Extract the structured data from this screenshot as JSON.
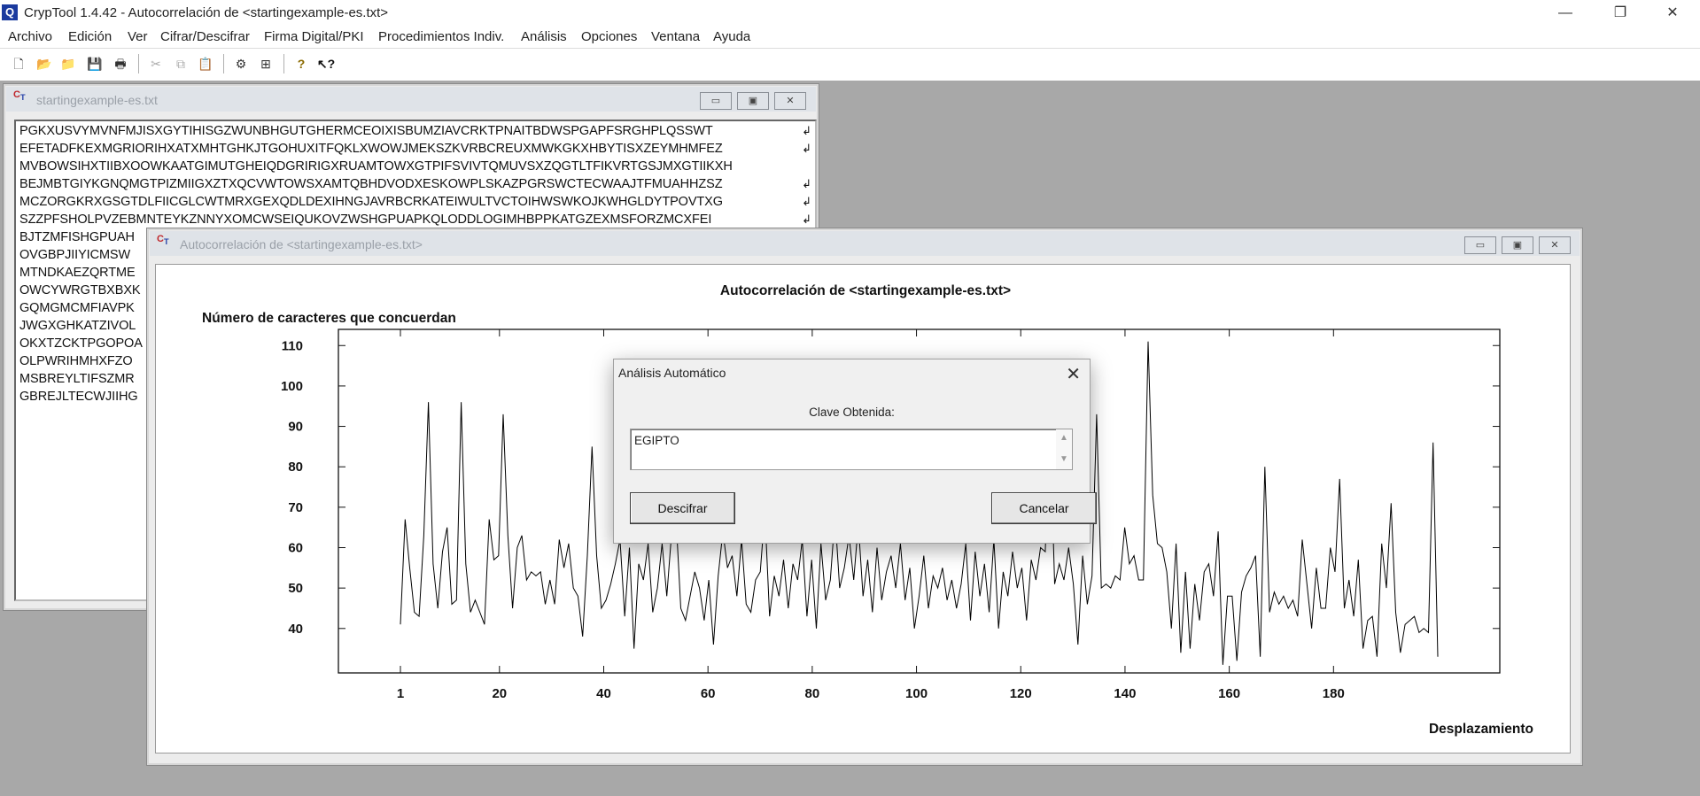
{
  "app": {
    "title": "CrypTool 1.4.42 - Autocorrelación de <startingexample-es.txt>",
    "icon_letter": "Q",
    "controls": {
      "minimize": "—",
      "restore": "❐",
      "close": "✕"
    }
  },
  "menu": [
    "Archivo",
    "Edición",
    "Ver",
    "Cifrar/Descifrar",
    "Firma Digital/PKI",
    "Procedimientos Indiv.",
    "Análisis",
    "Opciones",
    "Ventana",
    "Ayuda"
  ],
  "toolbar": {
    "icons": [
      "new-file-icon",
      "open-file-icon",
      "open-folder-icon",
      "save-icon",
      "print-icon",
      "cut-icon",
      "copy-icon",
      "paste-icon",
      "key-tool-icon",
      "windows-icon",
      "help-icon",
      "context-help-icon"
    ]
  },
  "text_window": {
    "title": "startingexample-es.txt",
    "lines": [
      "PGKXUSVYMVNFMJISXGYTIHISGZWUNBHGUTGHERMCEOIXISBUMZIAVCRKTPNAITBDWSPGAPFSRGHPLQSSWT",
      "EFETADFKEXMGRIORIHXATXMHTGHKJTGOHUXITFQKLXWOWJMEKSZKVRBCREUXMWKGKXHBYTISXZEYMHMFEZ",
      "MVBOWSIHXTIIBXOOWKAATGIMUTGHEIQDGRIRIGXRUAMTOWXGTPIFSVIVTQMUVSXZQGTLTFIKVRTGSJMXGTIIKXH",
      "BEJMBTGIYKGNQMGTPIZMIIGXZTXQCVWTOWSXAMTQBHDVODXESKOWPLSKAZPGRSWCTECWAAJTFMUAHHZSZ",
      "MCZORGKRXGSGTDLFIICGLCWTMRXGEXQDLDEXIHNGJAVRBCRKATEIWULTVCTOIHWSWKOJKWHGLDYTPOVTXG",
      "SZZPFSHOLPVZEBMNTEYKZNNYXOMCWSEIQUKOVZWSHGPUAPKQLODDLOGIMHBPPKATGZEXMSFORZMCXFEI",
      "BJTZMFISHGPUAH",
      "OVGBPJIIYICMSW",
      "MTNDKAEZQRTME",
      "OWCYWRGTBXBXK",
      "GQMGMCMFIAVPK",
      "JWGXGHKATZIVOL",
      "OKXTZCKTPGOPOA",
      "OLPWRIHMHXFZO",
      "MSBREYLTIFSZMR",
      "GBREJLTECWJIIHG"
    ],
    "wrap_mark": "↲"
  },
  "chart_window": {
    "title": "Autocorrelación de <startingexample-es.txt>"
  },
  "chart_data": {
    "type": "line",
    "title": "Autocorrelación de <startingexample-es.txt>",
    "ylabel": "Número de caracteres que concuerdan",
    "xlabel": "Desplazamiento",
    "xlim": [
      1,
      200
    ],
    "ylim": [
      29,
      114
    ],
    "x_ticks": [
      "1",
      "20",
      "40",
      "60",
      "80",
      "100",
      "120",
      "140",
      "160",
      "180"
    ],
    "x_tick_values": [
      1,
      20,
      40,
      60,
      80,
      100,
      120,
      140,
      160,
      180
    ],
    "y_ticks": [
      40,
      50,
      60,
      70,
      80,
      90,
      100,
      110
    ],
    "grid": false,
    "series": [
      {
        "x_start": 1,
        "x_step": 1,
        "values": [
          41,
          67,
          55,
          44,
          43,
          63,
          96,
          56,
          45,
          59,
          65,
          46,
          47,
          96,
          56,
          44,
          47,
          44,
          41,
          67,
          57,
          58,
          93,
          63,
          45,
          60,
          63,
          52,
          54,
          53,
          54,
          46,
          52,
          46,
          62,
          55,
          61,
          50,
          48,
          38,
          58,
          85,
          58,
          45,
          47,
          51,
          56,
          62,
          43,
          60,
          35,
          56,
          52,
          61,
          44,
          50,
          61,
          48,
          63,
          67,
          45,
          42,
          48,
          54,
          50,
          42,
          52,
          36,
          53,
          64,
          55,
          58,
          48,
          62,
          46,
          44,
          52,
          54,
          69,
          43,
          53,
          48,
          57,
          45,
          56,
          52,
          62,
          43,
          57,
          40,
          61,
          47,
          52,
          68,
          50,
          55,
          63,
          52,
          66,
          48,
          57,
          44,
          60,
          47,
          54,
          58,
          50,
          61,
          47,
          55,
          40,
          48,
          58,
          45,
          53,
          50,
          55,
          47,
          52,
          45,
          51,
          61,
          42,
          59,
          48,
          56,
          44,
          62,
          40,
          54,
          48,
          59,
          50,
          55,
          42,
          57,
          52,
          60,
          59,
          91,
          51,
          56,
          52,
          60,
          51,
          36,
          58,
          46,
          53,
          93,
          50,
          51,
          50,
          53,
          52,
          65,
          56,
          58,
          52,
          52,
          111,
          73,
          61,
          60,
          54,
          40,
          61,
          34,
          54,
          35,
          51,
          42,
          54,
          56,
          48,
          64,
          31,
          48,
          48,
          32,
          49,
          53,
          55,
          58,
          33,
          80,
          44,
          49,
          46,
          48,
          45,
          47,
          43,
          62,
          51,
          40,
          55,
          45,
          45,
          60,
          54,
          77,
          45,
          52,
          43,
          57,
          35,
          42,
          43,
          33,
          61,
          50,
          71,
          44,
          34,
          41,
          42,
          43,
          39,
          40,
          39,
          86,
          33
        ]
      }
    ]
  },
  "dialog": {
    "title": "Análisis Automático",
    "close": "✕",
    "label": "Clave Obtenida:",
    "key_value": "EGIPTO",
    "scroll_up": "▲",
    "scroll_down": "▼",
    "decrypt_button": "Descifrar",
    "cancel_button": "Cancelar"
  }
}
